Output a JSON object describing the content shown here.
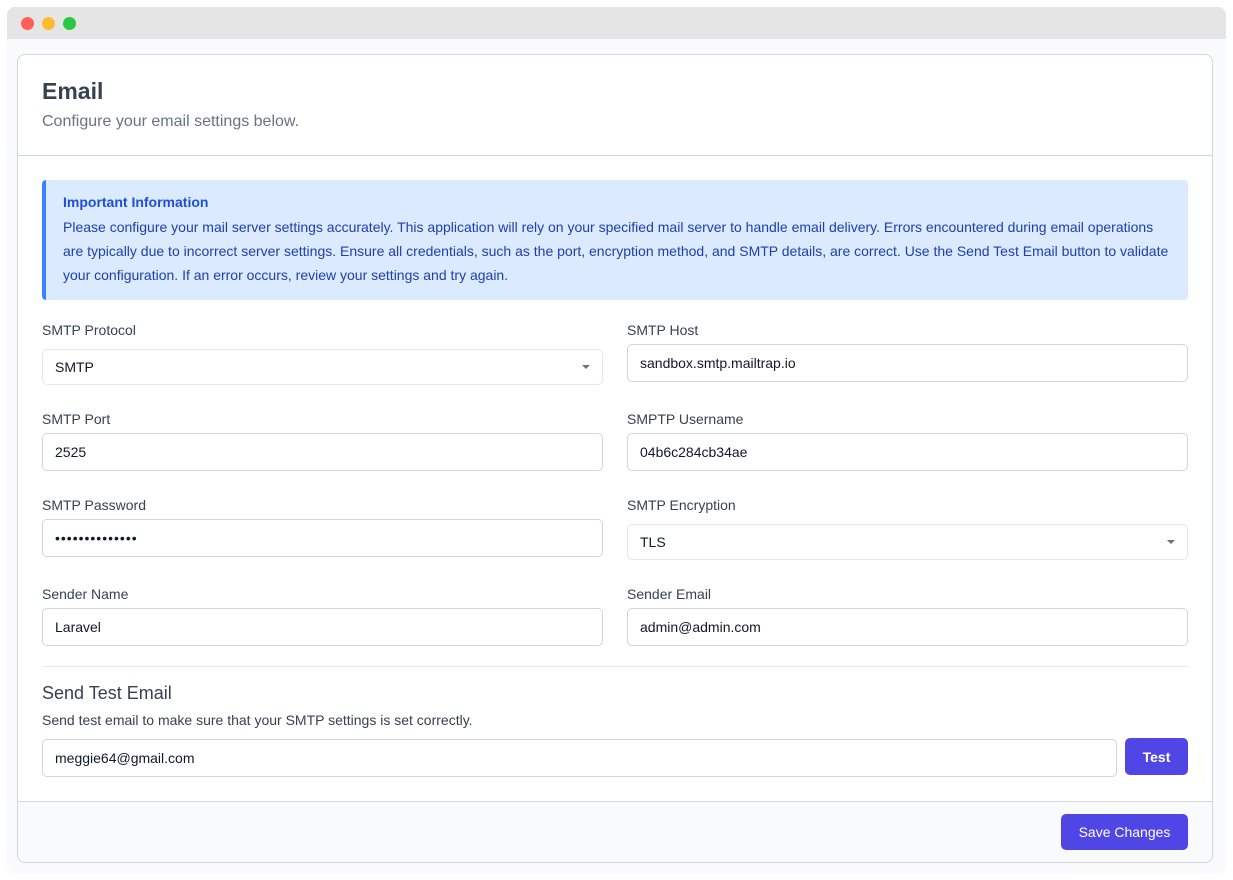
{
  "window": {
    "controls": [
      "close",
      "minimize",
      "zoom"
    ]
  },
  "header": {
    "title": "Email",
    "subtitle": "Configure your email settings below."
  },
  "info": {
    "title": "Important Information",
    "text": "Please configure your mail server settings accurately. This application will rely on your specified mail server to handle email delivery. Errors encountered during email operations are typically due to incorrect server settings. Ensure all credentials, such as the port, encryption method, and SMTP details, are correct. Use the Send Test Email button to validate your configuration. If an error occurs, review your settings and try again."
  },
  "form": {
    "protocol": {
      "label": "SMTP Protocol",
      "value": "SMTP"
    },
    "host": {
      "label": "SMTP Host",
      "value": "sandbox.smtp.mailtrap.io"
    },
    "port": {
      "label": "SMTP Port",
      "value": "2525"
    },
    "username": {
      "label": "SMPTP Username",
      "value": "04b6c284cb34ae"
    },
    "password": {
      "label": "SMTP Password",
      "value": "••••••••••••••"
    },
    "encryption": {
      "label": "SMTP Encryption",
      "value": "TLS"
    },
    "sender_name": {
      "label": "Sender Name",
      "value": "Laravel"
    },
    "sender_email": {
      "label": "Sender Email",
      "value": "admin@admin.com"
    }
  },
  "test": {
    "title": "Send Test Email",
    "subtitle": "Send test email to make sure that your SMTP settings is set correctly.",
    "email": "meggie64@gmail.com",
    "button": "Test"
  },
  "footer": {
    "save_label": "Save Changes"
  },
  "colors": {
    "primary": "#4f46e5",
    "info_bg": "#dbeafe",
    "info_border": "#3b82f6"
  }
}
